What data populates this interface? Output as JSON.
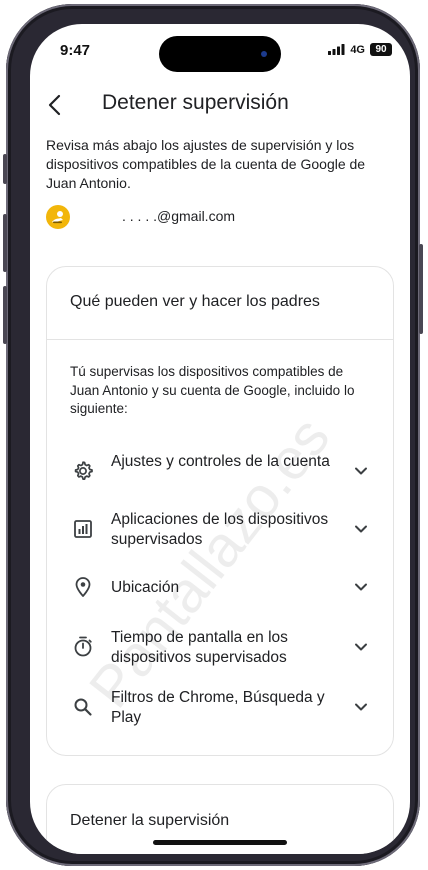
{
  "status_bar": {
    "time": "9:47",
    "network": "4G",
    "battery": "90"
  },
  "header": {
    "back_icon": "arrow-back-icon",
    "title": "Detener supervisión"
  },
  "intro_text": "Revisa más abajo los ajustes de supervisión y los dispositivos compatibles de la cuenta de Google de Juan Antonio.",
  "account": {
    "email": ". . . . .@gmail.com"
  },
  "parents_card": {
    "title": "Qué pueden ver y hacer los padres",
    "description": "Tú supervisas los dispositivos compatibles de Juan Antonio y su cuenta de Google, incluido lo siguiente:",
    "items": [
      {
        "label": "Ajustes y controles de la cuenta",
        "icon": "gear-icon"
      },
      {
        "label": "Aplicaciones de los dispositivos supervisados",
        "icon": "bar-chart-icon"
      },
      {
        "label": "Ubicación",
        "icon": "location-pin-icon"
      },
      {
        "label": "Tiempo de pantalla en los dispositivos supervisados",
        "icon": "timer-icon"
      },
      {
        "label": "Filtros de Chrome, Búsqueda y Play",
        "icon": "search-icon"
      }
    ]
  },
  "stop_card": {
    "title": "Detener la supervisión"
  },
  "watermark": "Pantallazo.es",
  "colors": {
    "text": "#202124",
    "card_border": "#e3e3e3",
    "avatar": "#f2b60a"
  }
}
